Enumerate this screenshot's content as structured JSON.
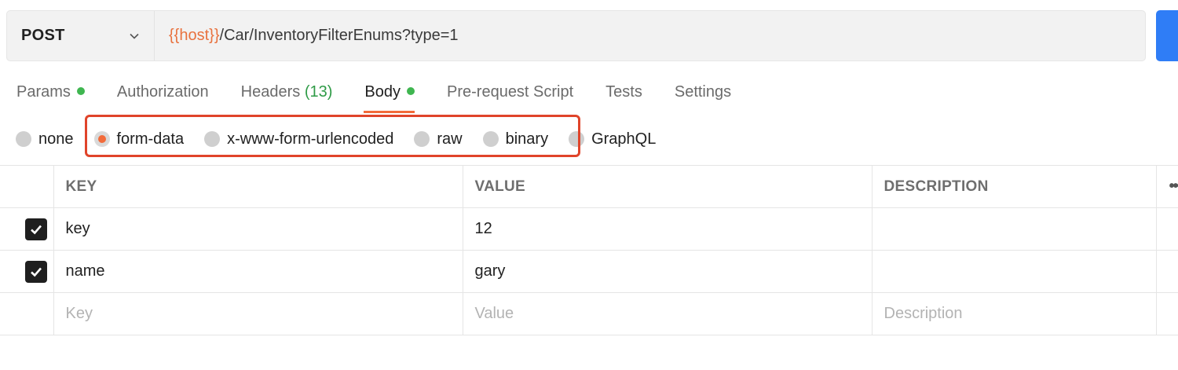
{
  "request": {
    "method": "POST",
    "url_variable": "{{host}}",
    "url_path": "/Car/InventoryFilterEnums?type=1"
  },
  "tabs": [
    {
      "label": "Params",
      "dot": true
    },
    {
      "label": "Authorization"
    },
    {
      "label": "Headers",
      "count": "(13)"
    },
    {
      "label": "Body",
      "dot": true,
      "active": true
    },
    {
      "label": "Pre-request Script"
    },
    {
      "label": "Tests"
    },
    {
      "label": "Settings"
    }
  ],
  "body_types": {
    "none": "none",
    "form_data": "form-data",
    "urlencoded": "x-www-form-urlencoded",
    "raw": "raw",
    "binary": "binary",
    "graphql": "GraphQL",
    "selected": "form-data"
  },
  "table": {
    "headers": {
      "key": "KEY",
      "value": "VALUE",
      "description": "DESCRIPTION",
      "more": "•••"
    },
    "rows": [
      {
        "checked": true,
        "key": "key",
        "value": "12",
        "description": ""
      },
      {
        "checked": true,
        "key": "name",
        "value": "gary",
        "description": ""
      }
    ],
    "placeholders": {
      "key": "Key",
      "value": "Value",
      "description": "Description"
    }
  },
  "colors": {
    "accent": "#f26b3a",
    "send": "#2f7df6",
    "status_dot": "#3fb650",
    "highlight": "#e0442a"
  }
}
